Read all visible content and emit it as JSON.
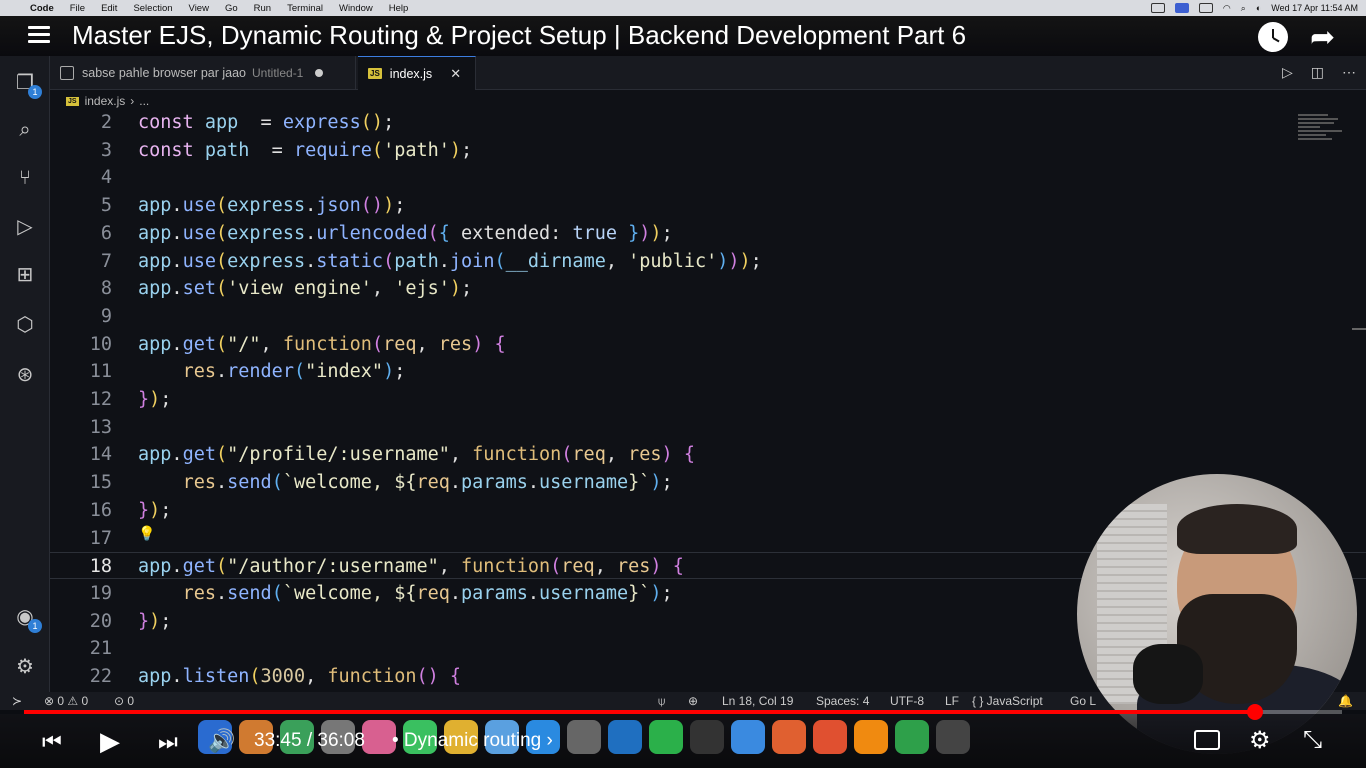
{
  "menubar": {
    "app": "Code",
    "items": [
      "File",
      "Edit",
      "Selection",
      "View",
      "Go",
      "Run",
      "Terminal",
      "Window",
      "Help"
    ],
    "datetime": "Wed 17 Apr  11:54 AM"
  },
  "video": {
    "title": "Master EJS, Dynamic Routing & Project Setup | Backend Development Part 6",
    "current_time": "33:45",
    "separator": "/",
    "duration": "36:08",
    "chapter": "• Dynamic routing",
    "chapter_arrow": "›",
    "progress": 0.934
  },
  "tabs": [
    {
      "label": "sabse pahle browser par jaao",
      "sub": "Untitled-1",
      "modified": true
    },
    {
      "label": "index.js",
      "active": true,
      "close": "✕"
    }
  ],
  "breadcrumb": {
    "file": "index.js",
    "sep": "›",
    "rest": "..."
  },
  "activity_badges": {
    "explorer": "1",
    "accounts": "1"
  },
  "lines": [
    {
      "n": "2",
      "segs": [
        [
          "kw",
          "const "
        ],
        [
          "var",
          "app"
        ],
        [
          "",
          "  = "
        ],
        [
          "fn",
          "express"
        ],
        [
          "p1",
          "()"
        ],
        [
          "",
          ";"
        ]
      ]
    },
    {
      "n": "3",
      "segs": [
        [
          "kw",
          "const "
        ],
        [
          "var",
          "path"
        ],
        [
          "",
          "  = "
        ],
        [
          "fn",
          "require"
        ],
        [
          "p1",
          "("
        ],
        [
          "str",
          "'path'"
        ],
        [
          "p1",
          ")"
        ],
        [
          "",
          ";"
        ]
      ]
    },
    {
      "n": "4",
      "segs": []
    },
    {
      "n": "5",
      "segs": [
        [
          "var",
          "app"
        ],
        [
          "",
          "."
        ],
        [
          "fn",
          "use"
        ],
        [
          "p1",
          "("
        ],
        [
          "var",
          "express"
        ],
        [
          "",
          "."
        ],
        [
          "fn",
          "json"
        ],
        [
          "p2",
          "()"
        ],
        [
          "p1",
          ")"
        ],
        [
          "",
          ";"
        ]
      ]
    },
    {
      "n": "6",
      "segs": [
        [
          "var",
          "app"
        ],
        [
          "",
          "."
        ],
        [
          "fn",
          "use"
        ],
        [
          "p1",
          "("
        ],
        [
          "var",
          "express"
        ],
        [
          "",
          "."
        ],
        [
          "fn",
          "urlencoded"
        ],
        [
          "p2",
          "("
        ],
        [
          "p3",
          "{ "
        ],
        [
          "",
          "extended: "
        ],
        [
          "bool",
          "true"
        ],
        [
          "p3",
          " }"
        ],
        [
          "p2",
          ")"
        ],
        [
          "p1",
          ")"
        ],
        [
          "",
          ";"
        ]
      ]
    },
    {
      "n": "7",
      "segs": [
        [
          "var",
          "app"
        ],
        [
          "",
          "."
        ],
        [
          "fn",
          "use"
        ],
        [
          "p1",
          "("
        ],
        [
          "var",
          "express"
        ],
        [
          "",
          "."
        ],
        [
          "fn",
          "static"
        ],
        [
          "p2",
          "("
        ],
        [
          "var",
          "path"
        ],
        [
          "",
          "."
        ],
        [
          "fn",
          "join"
        ],
        [
          "p3",
          "("
        ],
        [
          "var",
          "__dirname"
        ],
        [
          "",
          ", "
        ],
        [
          "str",
          "'public'"
        ],
        [
          "p3",
          ")"
        ],
        [
          "p2",
          ")"
        ],
        [
          "p1",
          ")"
        ],
        [
          "",
          ";"
        ]
      ]
    },
    {
      "n": "8",
      "segs": [
        [
          "var",
          "app"
        ],
        [
          "",
          "."
        ],
        [
          "fn",
          "set"
        ],
        [
          "p1",
          "("
        ],
        [
          "str",
          "'view engine'"
        ],
        [
          "",
          ", "
        ],
        [
          "str",
          "'ejs'"
        ],
        [
          "p1",
          ")"
        ],
        [
          "",
          ";"
        ]
      ]
    },
    {
      "n": "9",
      "segs": []
    },
    {
      "n": "10",
      "segs": [
        [
          "var",
          "app"
        ],
        [
          "",
          "."
        ],
        [
          "fn",
          "get"
        ],
        [
          "p1",
          "("
        ],
        [
          "str",
          "\"/\""
        ],
        [
          "",
          ", "
        ],
        [
          "k2",
          "function"
        ],
        [
          "p2",
          "("
        ],
        [
          "param",
          "req"
        ],
        [
          "",
          ", "
        ],
        [
          "param",
          "res"
        ],
        [
          "p2",
          ")"
        ],
        [
          "",
          " "
        ],
        [
          "p2",
          "{"
        ]
      ]
    },
    {
      "n": "11",
      "segs": [
        [
          "",
          "    "
        ],
        [
          "param",
          "res"
        ],
        [
          "",
          "."
        ],
        [
          "fn",
          "render"
        ],
        [
          "p3",
          "("
        ],
        [
          "str",
          "\"index\""
        ],
        [
          "p3",
          ")"
        ],
        [
          "",
          ";"
        ]
      ]
    },
    {
      "n": "12",
      "segs": [
        [
          "p2",
          "}"
        ],
        [
          "p1",
          ")"
        ],
        [
          "",
          ";"
        ]
      ]
    },
    {
      "n": "13",
      "segs": []
    },
    {
      "n": "14",
      "segs": [
        [
          "var",
          "app"
        ],
        [
          "",
          "."
        ],
        [
          "fn",
          "get"
        ],
        [
          "p1",
          "("
        ],
        [
          "str",
          "\"/profile/:username\""
        ],
        [
          "",
          ", "
        ],
        [
          "k2",
          "function"
        ],
        [
          "p2",
          "("
        ],
        [
          "param",
          "req"
        ],
        [
          "",
          ", "
        ],
        [
          "param",
          "res"
        ],
        [
          "p2",
          ")"
        ],
        [
          "",
          " "
        ],
        [
          "p2",
          "{"
        ]
      ]
    },
    {
      "n": "15",
      "segs": [
        [
          "",
          "    "
        ],
        [
          "param",
          "res"
        ],
        [
          "",
          "."
        ],
        [
          "fn",
          "send"
        ],
        [
          "p3",
          "("
        ],
        [
          "str",
          "`welcome, ${"
        ],
        [
          "param",
          "req"
        ],
        [
          "",
          "."
        ],
        [
          "var",
          "params"
        ],
        [
          "",
          "."
        ],
        [
          "var",
          "username"
        ],
        [
          "str",
          "}`"
        ],
        [
          "p3",
          ")"
        ],
        [
          "",
          ";"
        ]
      ]
    },
    {
      "n": "16",
      "segs": [
        [
          "p2",
          "}"
        ],
        [
          "p1",
          ")"
        ],
        [
          "",
          ";"
        ]
      ]
    },
    {
      "n": "17",
      "segs": []
    },
    {
      "n": "18",
      "current": true,
      "segs": [
        [
          "var",
          "app"
        ],
        [
          "",
          "."
        ],
        [
          "fn",
          "get"
        ],
        [
          "p1",
          "("
        ],
        [
          "str",
          "\"/author/:username\""
        ],
        [
          "",
          ", "
        ],
        [
          "k2",
          "function"
        ],
        [
          "p2",
          "("
        ],
        [
          "param",
          "req"
        ],
        [
          "",
          ", "
        ],
        [
          "param",
          "res"
        ],
        [
          "p2",
          ")"
        ],
        [
          "",
          " "
        ],
        [
          "p2",
          "{"
        ]
      ]
    },
    {
      "n": "19",
      "segs": [
        [
          "",
          "    "
        ],
        [
          "param",
          "res"
        ],
        [
          "",
          "."
        ],
        [
          "fn",
          "send"
        ],
        [
          "p3",
          "("
        ],
        [
          "str",
          "`welcome, ${"
        ],
        [
          "param",
          "req"
        ],
        [
          "",
          "."
        ],
        [
          "var",
          "params"
        ],
        [
          "",
          "."
        ],
        [
          "var",
          "username"
        ],
        [
          "str",
          "}`"
        ],
        [
          "p3",
          ")"
        ],
        [
          "",
          ";"
        ]
      ]
    },
    {
      "n": "20",
      "segs": [
        [
          "p2",
          "}"
        ],
        [
          "p1",
          ")"
        ],
        [
          "",
          ";"
        ]
      ]
    },
    {
      "n": "21",
      "segs": []
    },
    {
      "n": "22",
      "segs": [
        [
          "var",
          "app"
        ],
        [
          "",
          "."
        ],
        [
          "fn",
          "listen"
        ],
        [
          "p1",
          "("
        ],
        [
          "num",
          "3000"
        ],
        [
          "",
          ", "
        ],
        [
          "k2",
          "function"
        ],
        [
          "p2",
          "()"
        ],
        [
          "",
          " "
        ],
        [
          "p2",
          "{"
        ]
      ]
    }
  ],
  "status": {
    "errors": "0",
    "warnings": "0",
    "ports": "0",
    "position": "Ln 18, Col 19",
    "spaces": "Spaces: 4",
    "encoding": "UTF-8",
    "eol": "LF",
    "language": "{ } JavaScript",
    "golive": "Go L"
  },
  "colors": {
    "progress": "#ff0000",
    "editor_bg": "#0f1116",
    "accent": "#3c7de0"
  }
}
